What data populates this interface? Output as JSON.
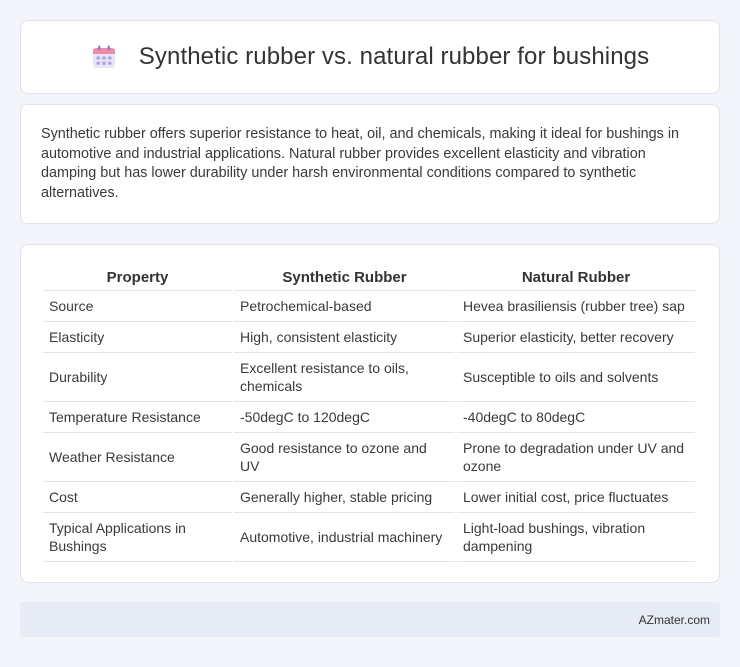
{
  "header": {
    "title": "Synthetic rubber vs. natural rubber for bushings",
    "icon": "calendar-icon"
  },
  "summary": {
    "text": "Synthetic rubber offers superior resistance to heat, oil, and chemicals, making it ideal for bushings in automotive and industrial applications. Natural rubber provides excellent elasticity and vibration damping but has lower durability under harsh environmental conditions compared to synthetic alternatives."
  },
  "table": {
    "headers": [
      "Property",
      "Synthetic Rubber",
      "Natural Rubber"
    ],
    "rows": [
      [
        "Source",
        "Petrochemical-based",
        "Hevea brasiliensis (rubber tree) sap"
      ],
      [
        "Elasticity",
        "High, consistent elasticity",
        "Superior elasticity, better recovery"
      ],
      [
        "Durability",
        "Excellent resistance to oils, chemicals",
        "Susceptible to oils and solvents"
      ],
      [
        "Temperature Resistance",
        "-50degC to 120degC",
        "-40degC to 80degC"
      ],
      [
        "Weather Resistance",
        "Good resistance to ozone and UV",
        "Prone to degradation under UV and ozone"
      ],
      [
        "Cost",
        "Generally higher, stable pricing",
        "Lower initial cost, price fluctuates"
      ],
      [
        "Typical Applications in Bushings",
        "Automotive, industrial machinery",
        "Light-load bushings, vibration dampening"
      ]
    ]
  },
  "footer": {
    "text": "AZmater.com"
  }
}
